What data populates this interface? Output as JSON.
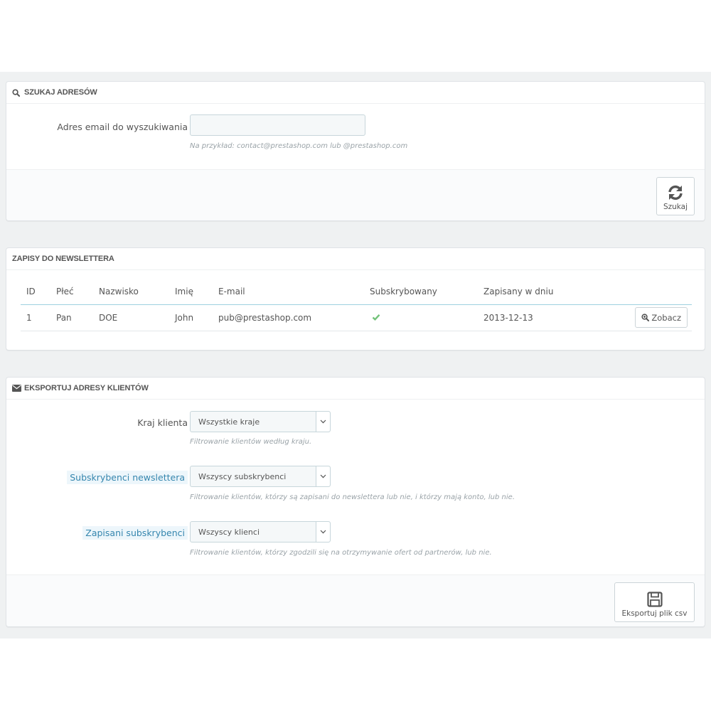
{
  "search_panel": {
    "title": "SZUKAJ ADRESÓW",
    "email_label": "Adres email do wyszukiwania",
    "email_value": "",
    "email_help": "Na przykład: contact@prestashop.com lub @prestashop.com",
    "search_button": "Szukaj"
  },
  "newsletter_panel": {
    "title": "ZAPISY DO NEWSLETTERA",
    "columns": [
      "ID",
      "Płeć",
      "Nazwisko",
      "Imię",
      "E-mail",
      "Subskrybowany",
      "Zapisany w dniu"
    ],
    "rows": [
      {
        "id": "1",
        "gender": "Pan",
        "lastname": "DOE",
        "firstname": "John",
        "email": "pub@prestashop.com",
        "subscribed": true,
        "date": "2013-12-13"
      }
    ],
    "view_button": "Zobacz"
  },
  "export_panel": {
    "title": "EKSPORTUJ ADRESY KLIENTÓW",
    "country_label": "Kraj klienta",
    "country_value": "Wszystkie kraje",
    "country_help": "Filtrowanie klientów według kraju.",
    "newsletter_label": "Subskrybenci newslettera",
    "newsletter_value": "Wszyscy subskrybenci",
    "newsletter_help": "Filtrowanie klientów, którzy są zapisani do newslettera lub nie, i którzy mają konto, lub nie.",
    "optin_label": "Zapisani subskrybenci",
    "optin_value": "Wszyscy klienci",
    "optin_help": "Filtrowanie klientów, którzy zgodzili się na otrzymywanie ofert od partnerów, lub nie.",
    "export_button": "Eksportuj plik csv"
  },
  "colors": {
    "background": "#eff1f2",
    "check": "#72c279",
    "highlight_label": "#3586ae"
  },
  "icons": [
    "search-icon",
    "refresh-icon",
    "check-icon",
    "zoom-in-icon",
    "envelope-icon",
    "chevron-down-icon",
    "save-icon"
  ]
}
